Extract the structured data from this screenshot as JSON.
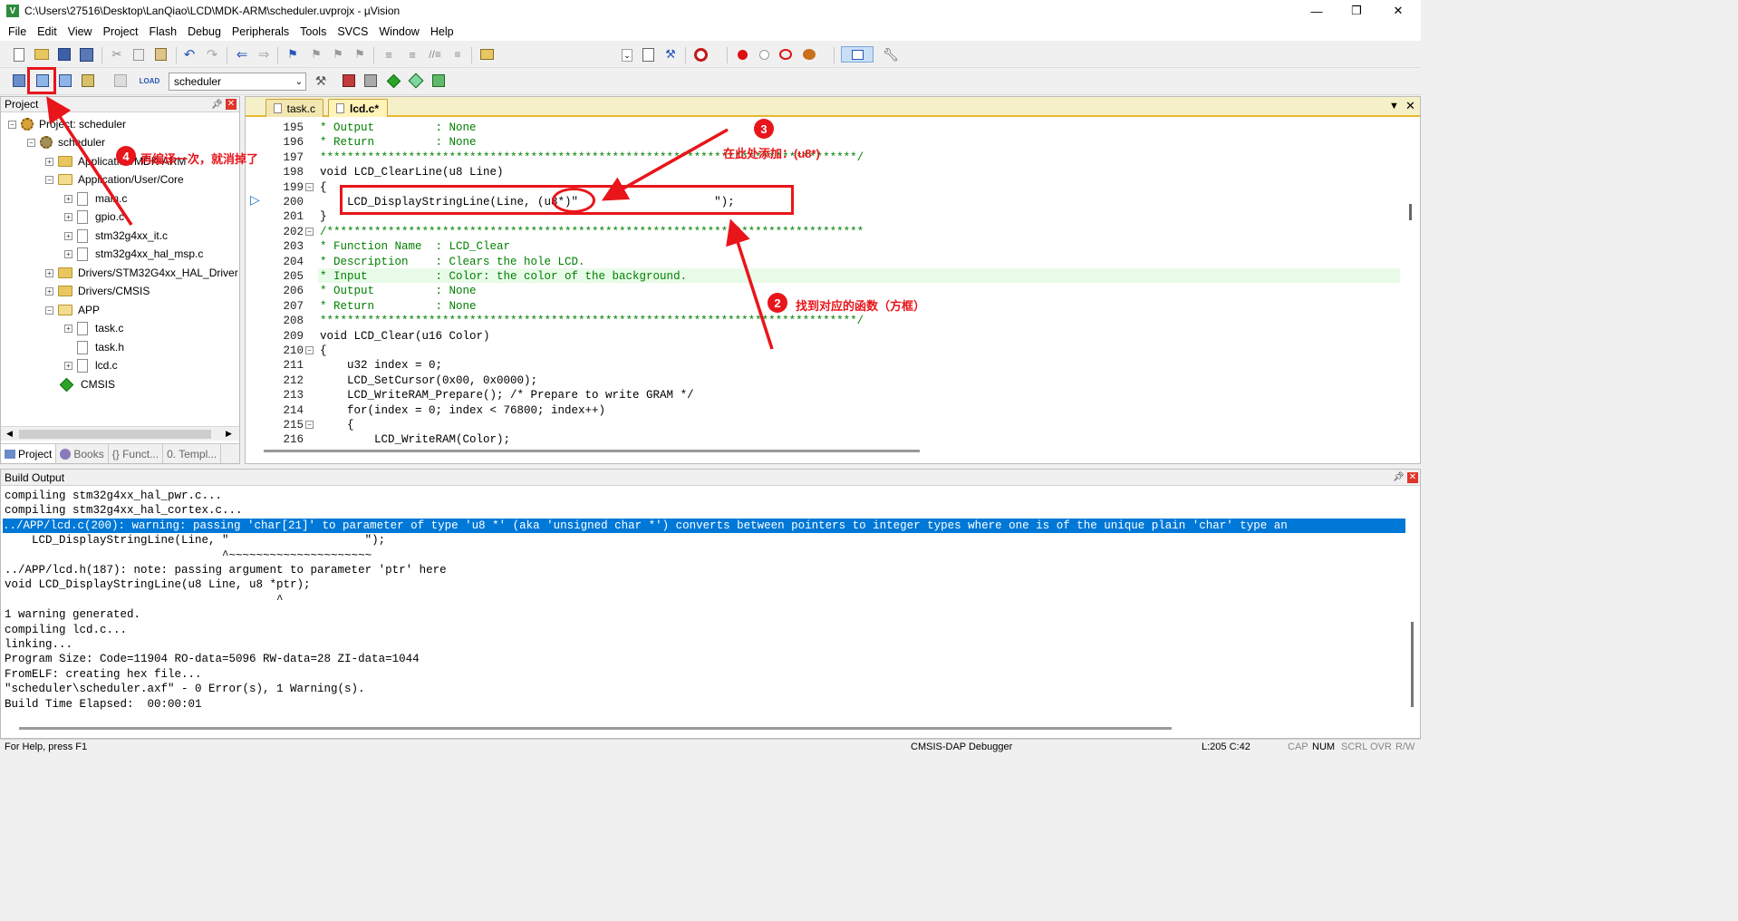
{
  "window": {
    "title": "C:\\Users\\27516\\Desktop\\LanQiao\\LCD\\MDK-ARM\\scheduler.uvprojx - µVision",
    "minimize": "—",
    "maximize": "❐",
    "close": "✕"
  },
  "menu": [
    "File",
    "Edit",
    "View",
    "Project",
    "Flash",
    "Debug",
    "Peripherals",
    "Tools",
    "SVCS",
    "Window",
    "Help"
  ],
  "target_select": {
    "value": "scheduler"
  },
  "project_panel": {
    "title": "Project",
    "tree": [
      {
        "label": "Project: scheduler"
      },
      {
        "label": "scheduler"
      },
      {
        "label": "Application/MDK-ARM"
      },
      {
        "label": "Application/User/Core"
      },
      {
        "label": "main.c"
      },
      {
        "label": "gpio.c"
      },
      {
        "label": "stm32g4xx_it.c"
      },
      {
        "label": "stm32g4xx_hal_msp.c"
      },
      {
        "label": "Drivers/STM32G4xx_HAL_Driver"
      },
      {
        "label": "Drivers/CMSIS"
      },
      {
        "label": "APP"
      },
      {
        "label": "task.c"
      },
      {
        "label": "task.h"
      },
      {
        "label": "lcd.c"
      },
      {
        "label": "CMSIS"
      }
    ],
    "tabs": [
      "Project",
      "Books",
      "{} Funct...",
      "0. Templ..."
    ]
  },
  "editor": {
    "tabs": [
      "task.c",
      "lcd.c*"
    ],
    "lines": [
      {
        "n": "195",
        "text": "* Output         : None"
      },
      {
        "n": "196",
        "text": "* Return         : None"
      },
      {
        "n": "197",
        "text": "*******************************************************************************/"
      },
      {
        "n": "198",
        "text": "void LCD_ClearLine(u8 Line)"
      },
      {
        "n": "199",
        "text": "{"
      },
      {
        "n": "200",
        "text": "    LCD_DisplayStringLine(Line, (u8*)\"                    \");"
      },
      {
        "n": "201",
        "text": "}"
      },
      {
        "n": "202",
        "text": "/*******************************************************************************"
      },
      {
        "n": "203",
        "text": "* Function Name  : LCD_Clear"
      },
      {
        "n": "204",
        "text": "* Description    : Clears the hole LCD."
      },
      {
        "n": "205",
        "text": "* Input          : Color: the color of the background."
      },
      {
        "n": "206",
        "text": "* Output         : None"
      },
      {
        "n": "207",
        "text": "* Return         : None"
      },
      {
        "n": "208",
        "text": "*******************************************************************************/"
      },
      {
        "n": "209",
        "text": "void LCD_Clear(u16 Color)"
      },
      {
        "n": "210",
        "text": "{"
      },
      {
        "n": "211",
        "text": "    u32 index = 0;"
      },
      {
        "n": "212",
        "text": "    LCD_SetCursor(0x00, 0x0000);"
      },
      {
        "n": "213",
        "text": "    LCD_WriteRAM_Prepare(); /* Prepare to write GRAM */"
      },
      {
        "n": "214",
        "text": "    for(index = 0; index < 76800; index++)"
      },
      {
        "n": "215",
        "text": "    {"
      },
      {
        "n": "216",
        "text": "        LCD_WriteRAM(Color);"
      }
    ]
  },
  "build_output": {
    "title": "Build Output",
    "lines": [
      "compiling stm32g4xx_hal_pwr.c...",
      "compiling stm32g4xx_hal_cortex.c...",
      "../APP/lcd.c(200): warning: passing 'char[21]' to parameter of type 'u8 *' (aka 'unsigned char *') converts between pointers to integer types where one is of the unique plain 'char' type an",
      "    LCD_DisplayStringLine(Line, \"                    \");",
      "                                ^~~~~~~~~~~~~~~~~~~~~~",
      "../APP/lcd.h(187): note: passing argument to parameter 'ptr' here",
      "void LCD_DisplayStringLine(u8 Line, u8 *ptr);",
      "                                        ^",
      "1 warning generated.",
      "compiling lcd.c...",
      "linking...",
      "Program Size: Code=11904 RO-data=5096 RW-data=28 ZI-data=1044",
      "FromELF: creating hex file...",
      "\"scheduler\\scheduler.axf\" - 0 Error(s), 1 Warning(s).",
      "Build Time Elapsed:  00:00:01"
    ]
  },
  "status": {
    "help": "For Help, press F1",
    "debugger": "CMSIS-DAP Debugger",
    "position": "L:205 C:42",
    "cap": "CAP",
    "num": "NUM",
    "scrl": "SCRL",
    "ovr": "OVR",
    "rw": "R/W"
  },
  "annotations": {
    "a2": {
      "num": "2",
      "text": "找到对应的函数（方框）"
    },
    "a3": {
      "num": "3",
      "text": "在此处添加：(u8*)"
    },
    "a4": {
      "num": "4",
      "text": "再编译一次，就消掉了"
    },
    "color": "#e8151b"
  }
}
